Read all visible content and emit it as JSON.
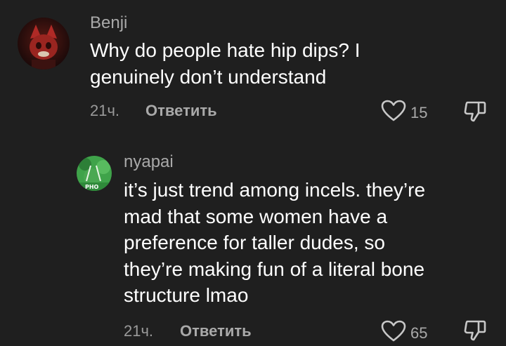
{
  "comments": [
    {
      "username": "Benji",
      "lines": [
        "Why do people hate hip dips? I",
        "genuinely don’t understand"
      ],
      "time": "21ч.",
      "reply_label": "Ответить",
      "likes": "15"
    },
    {
      "username": "nyapai",
      "avatar_text": "PHO",
      "lines": [
        "it’s just trend among incels. they’re",
        "mad that some women have a",
        "preference for taller dudes, so",
        "they’re making fun of a literal bone",
        "structure lmao"
      ],
      "time": "21ч.",
      "reply_label": "Ответить",
      "likes": "65"
    }
  ],
  "icons": {
    "like": "heart-outline-icon",
    "dislike": "thumbs-down-outline-icon"
  },
  "colors": {
    "background": "#1f1f1f",
    "text": "#ffffff",
    "secondary": "#a9a9a9"
  }
}
